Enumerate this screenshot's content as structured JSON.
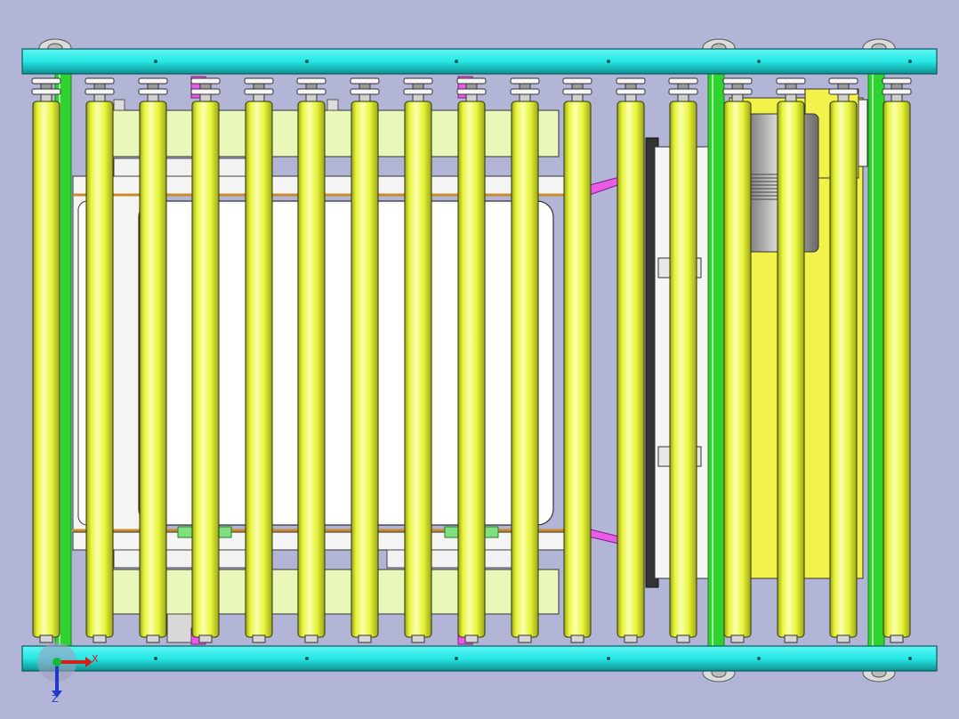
{
  "viewport": {
    "background": "#b3b5d7"
  },
  "colors": {
    "frame_rail": "#27e8e6",
    "frame_rail_dark": "#0e8f90",
    "roller": "#e8f53a",
    "roller_highlight": "#fbffb0",
    "roller_shadow": "#9aa617",
    "side_frame": "#2fd22f",
    "side_frame_dark": "#158a15",
    "cross_plate": "#e9f7b8",
    "window": "#ffffff",
    "bracket_magenta": "#e85ce8",
    "motor_grey": "#a8aaa8",
    "drive_yellow": "#f2f24a"
  },
  "model": {
    "roller_count": 17,
    "side_frame_count": 3,
    "foot_wheel_count": 4
  },
  "triad": {
    "icon": "coordinate-triad-icon",
    "x_label": "X",
    "z_label": "Z",
    "x_color": "#d0201c",
    "z_color": "#2037d0",
    "y_color": "#19b83a"
  }
}
